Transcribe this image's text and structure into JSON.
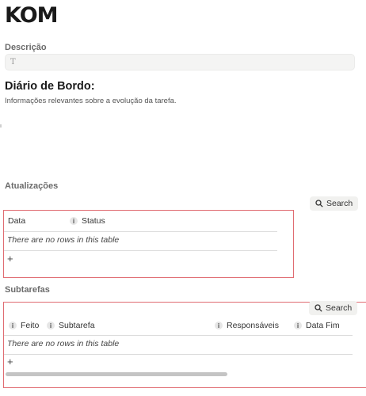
{
  "page": {
    "title": "KOM"
  },
  "descricao": {
    "label": "Descrição",
    "icon": "text-type-icon",
    "placeholder_glyph": "T"
  },
  "diario": {
    "title": "Diário de Bordo:",
    "subtitle": "Informações relevantes sobre a evolução da tarefa."
  },
  "atualizacoes": {
    "label": "Atualizações",
    "search_label": "Search",
    "columns": [
      {
        "label": "Data",
        "info": false
      },
      {
        "label": "Status",
        "info": true
      }
    ],
    "empty_text": "There are no rows in this table",
    "add_glyph": "+"
  },
  "subtarefas": {
    "label": "Subtarefas",
    "search_label": "Search",
    "columns": [
      {
        "label": "Feito",
        "info": true
      },
      {
        "label": "Subtarefa",
        "info": true
      },
      {
        "label": "Responsáveis",
        "info": true
      },
      {
        "label": "Data Fim",
        "info": true
      }
    ],
    "empty_text": "There are no rows in this table",
    "add_glyph": "+"
  },
  "colors": {
    "highlight_border": "#e06c72",
    "input_bg": "#f4f4f3",
    "button_bg": "#f1f1ef"
  }
}
